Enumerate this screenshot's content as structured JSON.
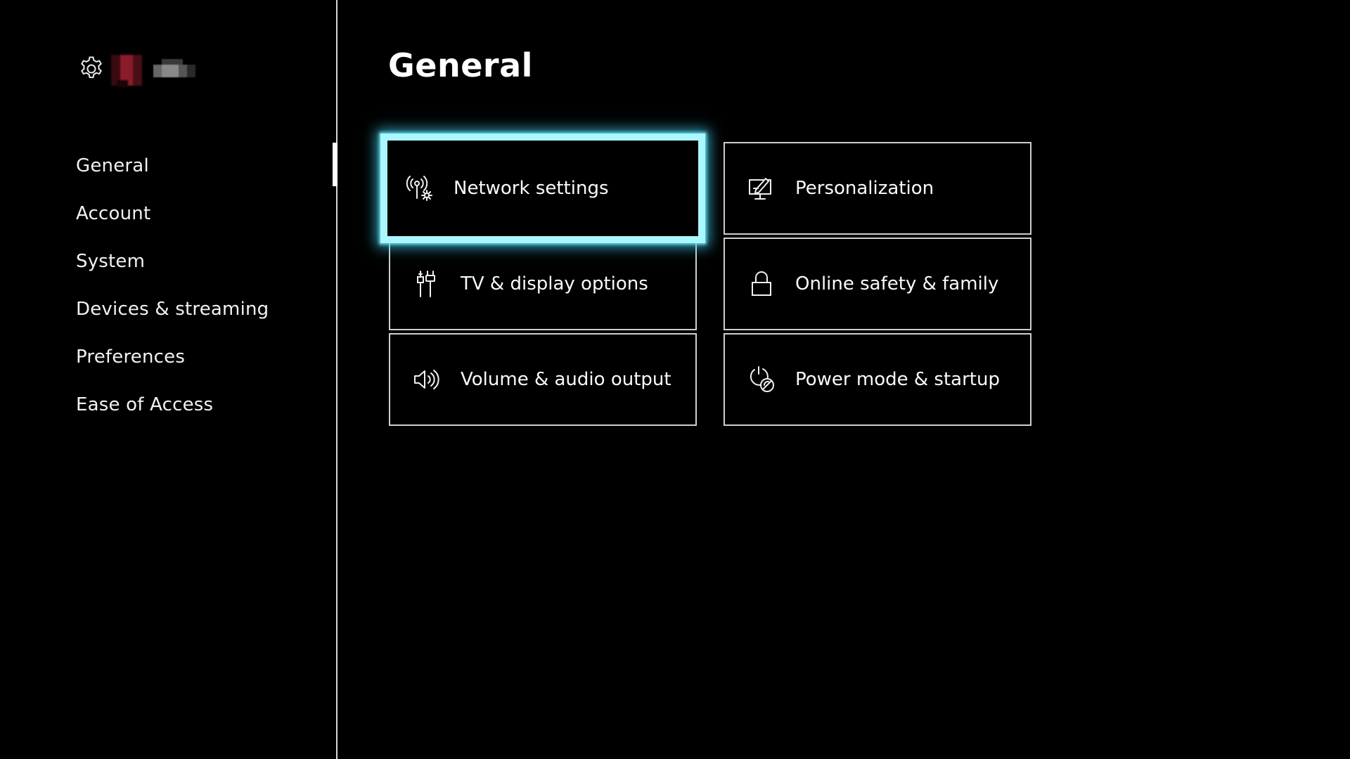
{
  "sidebar": {
    "header": {
      "icon": "gear-icon",
      "avatar": "obscured profile picture",
      "gamertag": ""
    },
    "items": [
      {
        "label": "General",
        "selected": true
      },
      {
        "label": "Account",
        "selected": false
      },
      {
        "label": "System",
        "selected": false
      },
      {
        "label": "Devices & streaming",
        "selected": false
      },
      {
        "label": "Preferences",
        "selected": false
      },
      {
        "label": "Ease of Access",
        "selected": false
      }
    ]
  },
  "main": {
    "title": "General",
    "tiles": [
      {
        "label": "Network settings",
        "icon": "network-settings-icon",
        "focused": true
      },
      {
        "label": "Personalization",
        "icon": "personalization-icon",
        "focused": false
      },
      {
        "label": "TV & display options",
        "icon": "tv-display-icon",
        "focused": false
      },
      {
        "label": "Online safety & family",
        "icon": "lock-icon",
        "focused": false
      },
      {
        "label": "Volume & audio output",
        "icon": "speaker-icon",
        "focused": false
      },
      {
        "label": "Power mode & startup",
        "icon": "power-leaf-icon",
        "focused": false
      }
    ]
  },
  "colors": {
    "background": "#000000",
    "text": "#ffffff",
    "focus_border": "#aaf7ff",
    "tile_border": "#cfcfcf"
  }
}
